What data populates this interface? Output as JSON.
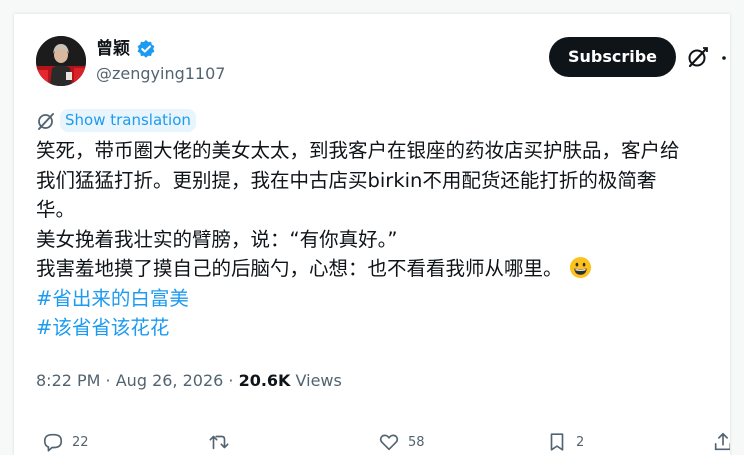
{
  "author": {
    "name": "曾颖",
    "handle": "@zengying1107",
    "verified": true
  },
  "header": {
    "subscribe_label": "Subscribe",
    "grok_icon": "grok-icon",
    "more_icon": "more-icon"
  },
  "translation": {
    "label": "Show translation"
  },
  "tweet": {
    "lines": [
      "笑死，带币圈大佬的美女太太，到我客户在银座的药妆店买护肤品，客户给",
      "我们猛猛打折。更别提，我在中古店买birkin不用配货还能打折的极简奢",
      "华。",
      "美女挽着我壮实的臂膀，说：“有你真好。”",
      "我害羞地摸了摸自己的后脑勺，心想：也不看看我师从哪里。"
    ],
    "emoji": "grinning-face-emoji",
    "hashtags": [
      "#省出来的白富美",
      "#该省省该花花"
    ]
  },
  "meta": {
    "time": "8:22 PM",
    "separator": " · ",
    "date": "Aug 26, 2026",
    "views_count": "20.6K",
    "views_label": "Views"
  },
  "actions": {
    "reply_count": "22",
    "retweet_count": "",
    "like_count": "58",
    "bookmark_count": "2"
  },
  "colors": {
    "accent": "#1d9bf0",
    "text": "#0f1419",
    "muted": "#536471",
    "button_bg": "#0f1419"
  }
}
